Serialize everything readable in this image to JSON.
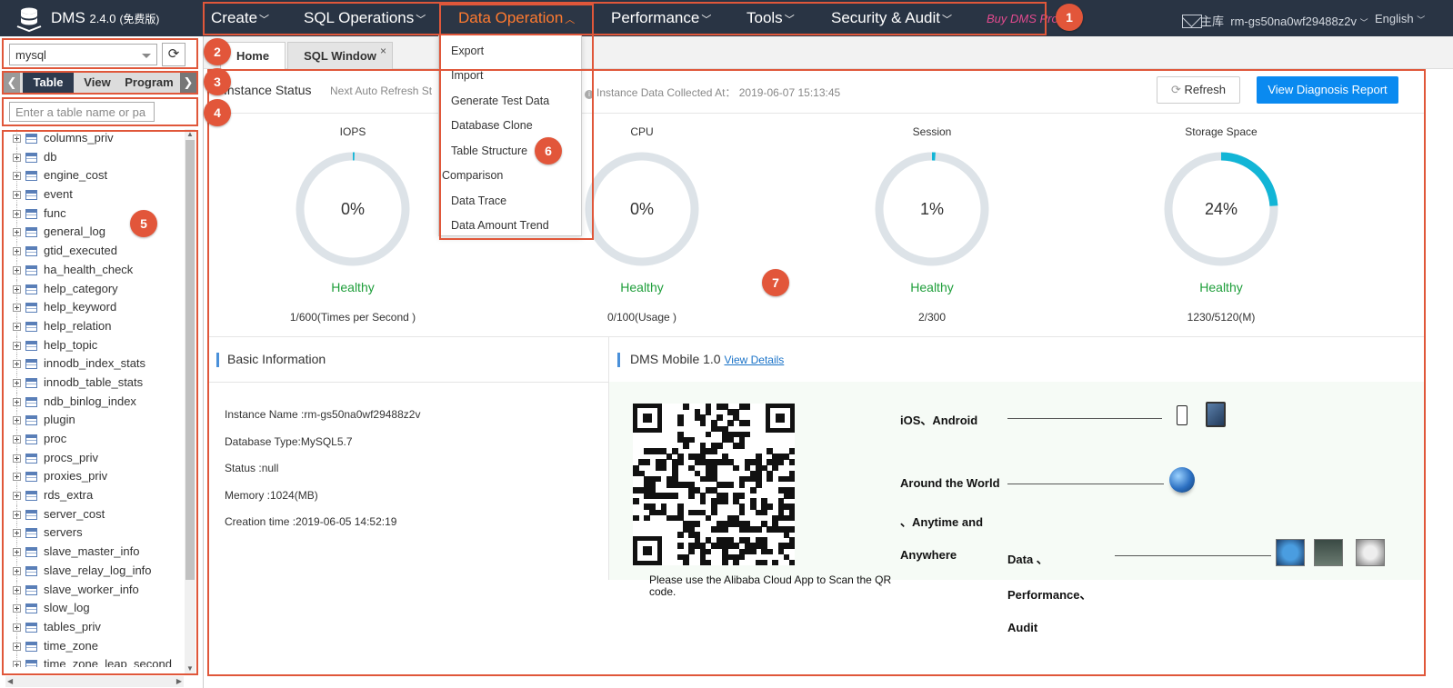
{
  "app": {
    "name": "DMS",
    "version": "2.4.0",
    "edition": "(免费版)"
  },
  "nav": [
    {
      "label": "Create"
    },
    {
      "label": "SQL Operations"
    },
    {
      "label": "Data Operation"
    },
    {
      "label": "Performance"
    },
    {
      "label": "Tools"
    },
    {
      "label": "Security & Audit"
    }
  ],
  "buy_label": "Buy DMS Pro",
  "topright": {
    "role": "主库",
    "instance": "rm-gs50na0wf29488z2v",
    "language": "English"
  },
  "badges": [
    "1",
    "2",
    "3",
    "4",
    "5",
    "6",
    "7"
  ],
  "left": {
    "db_select": "mysql",
    "object_tabs": [
      "Table",
      "View",
      "Program"
    ],
    "table_search_placeholder": "Enter a table name or pa",
    "tables": [
      "columns_priv",
      "db",
      "engine_cost",
      "event",
      "func",
      "general_log",
      "gtid_executed",
      "ha_health_check",
      "help_category",
      "help_keyword",
      "help_relation",
      "help_topic",
      "innodb_index_stats",
      "innodb_table_stats",
      "ndb_binlog_index",
      "plugin",
      "proc",
      "procs_priv",
      "proxies_priv",
      "rds_extra",
      "server_cost",
      "servers",
      "slave_master_info",
      "slave_relay_log_info",
      "slave_worker_info",
      "slow_log",
      "tables_priv",
      "time_zone",
      "time_zone_leap_second"
    ]
  },
  "window_tabs": [
    {
      "label": "Home"
    },
    {
      "label": "SQL Window"
    }
  ],
  "dropdown": [
    "Export",
    "Import",
    "Generate Test Data",
    "Database Clone",
    "Table Structure",
    "Comparison",
    "Data Trace",
    "Data Amount Trend"
  ],
  "instance_status": {
    "title": "Instance Status",
    "auto_refresh": "Next Auto Refresh St",
    "collected": "Instance Data Collected At： 2019-06-07 15:13:45",
    "refresh_label": "Refresh",
    "diagnosis_label": "View Diagnosis Report",
    "gauges": [
      {
        "name": "IOPS",
        "value": "0%",
        "fraction": 0.005,
        "status": "Healthy",
        "detail": "1/600(Times per Second )"
      },
      {
        "name": "CPU",
        "value": "0%",
        "fraction": 0.0,
        "status": "Healthy",
        "detail": "0/100(Usage )"
      },
      {
        "name": "Session",
        "value": "1%",
        "fraction": 0.01,
        "status": "Healthy",
        "detail": "2/300"
      },
      {
        "name": "Storage Space",
        "value": "24%",
        "fraction": 0.24,
        "status": "Healthy",
        "detail": "1230/5120(M)"
      }
    ]
  },
  "basic_info": {
    "title": "Basic Information",
    "lines": [
      "Instance Name :rm-gs50na0wf29488z2v",
      "Database Type:MySQL5.7",
      "Status :null",
      "Memory :1024(MB)",
      "Creation time :2019-06-05 14:52:19"
    ]
  },
  "mobile": {
    "title": "DMS Mobile 1.0",
    "details_link": "View Details",
    "qr_caption": "Please use the Alibaba Cloud App to Scan the QR code.",
    "platforms": "iOS、Android",
    "around": "Around the World",
    "anytime": "、Anytime and",
    "anywhere": "Anywhere",
    "data": "Data 、",
    "performance": "Performance、",
    "audit": "Audit"
  },
  "colors": {
    "topbar": "#293444",
    "active_nav": "#ff7a2f",
    "healthy": "#1e9e3a",
    "gauge_fill": "#12b5d6",
    "gauge_track": "#dde3e8",
    "primary": "#0a8af0",
    "annotation": "#e0573a"
  }
}
